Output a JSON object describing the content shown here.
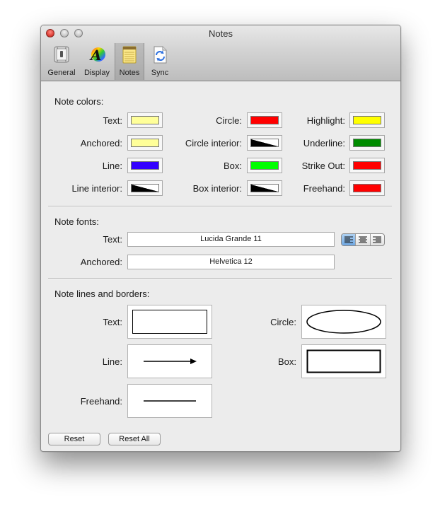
{
  "window": {
    "title": "Notes"
  },
  "toolbar": {
    "items": [
      {
        "label": "General",
        "icon": "switch-icon"
      },
      {
        "label": "Display",
        "icon": "font-color-icon"
      },
      {
        "label": "Notes",
        "icon": "notepad-icon",
        "selected": true
      },
      {
        "label": "Sync",
        "icon": "sync-document-icon"
      }
    ]
  },
  "colors": {
    "title": "Note colors:",
    "text": {
      "label": "Text:",
      "color": "#ffff99"
    },
    "anchored": {
      "label": "Anchored:",
      "color": "#ffff99"
    },
    "line": {
      "label": "Line:",
      "color": "#3300ff"
    },
    "line_interior": {
      "label": "Line interior:",
      "color": "none"
    },
    "circle": {
      "label": "Circle:",
      "color": "#ff0000"
    },
    "circle_interior": {
      "label": "Circle interior:",
      "color": "none"
    },
    "box": {
      "label": "Box:",
      "color": "#00ff00"
    },
    "box_interior": {
      "label": "Box interior:",
      "color": "none"
    },
    "highlight": {
      "label": "Highlight:",
      "color": "#ffff00"
    },
    "underline": {
      "label": "Underline:",
      "color": "#008c00"
    },
    "strike_out": {
      "label": "Strike Out:",
      "color": "#ff0000"
    },
    "freehand": {
      "label": "Freehand:",
      "color": "#ff0000"
    }
  },
  "fonts": {
    "title": "Note fonts:",
    "text": {
      "label": "Text:",
      "value": "Lucida Grande 11"
    },
    "anchored": {
      "label": "Anchored:",
      "value": "Helvetica 12"
    },
    "alignment": "left"
  },
  "lines": {
    "title": "Note lines and borders:",
    "text": {
      "label": "Text:"
    },
    "line": {
      "label": "Line:"
    },
    "freehand": {
      "label": "Freehand:"
    },
    "circle": {
      "label": "Circle:"
    },
    "box": {
      "label": "Box:"
    }
  },
  "buttons": {
    "reset": "Reset",
    "reset_all": "Reset All"
  }
}
